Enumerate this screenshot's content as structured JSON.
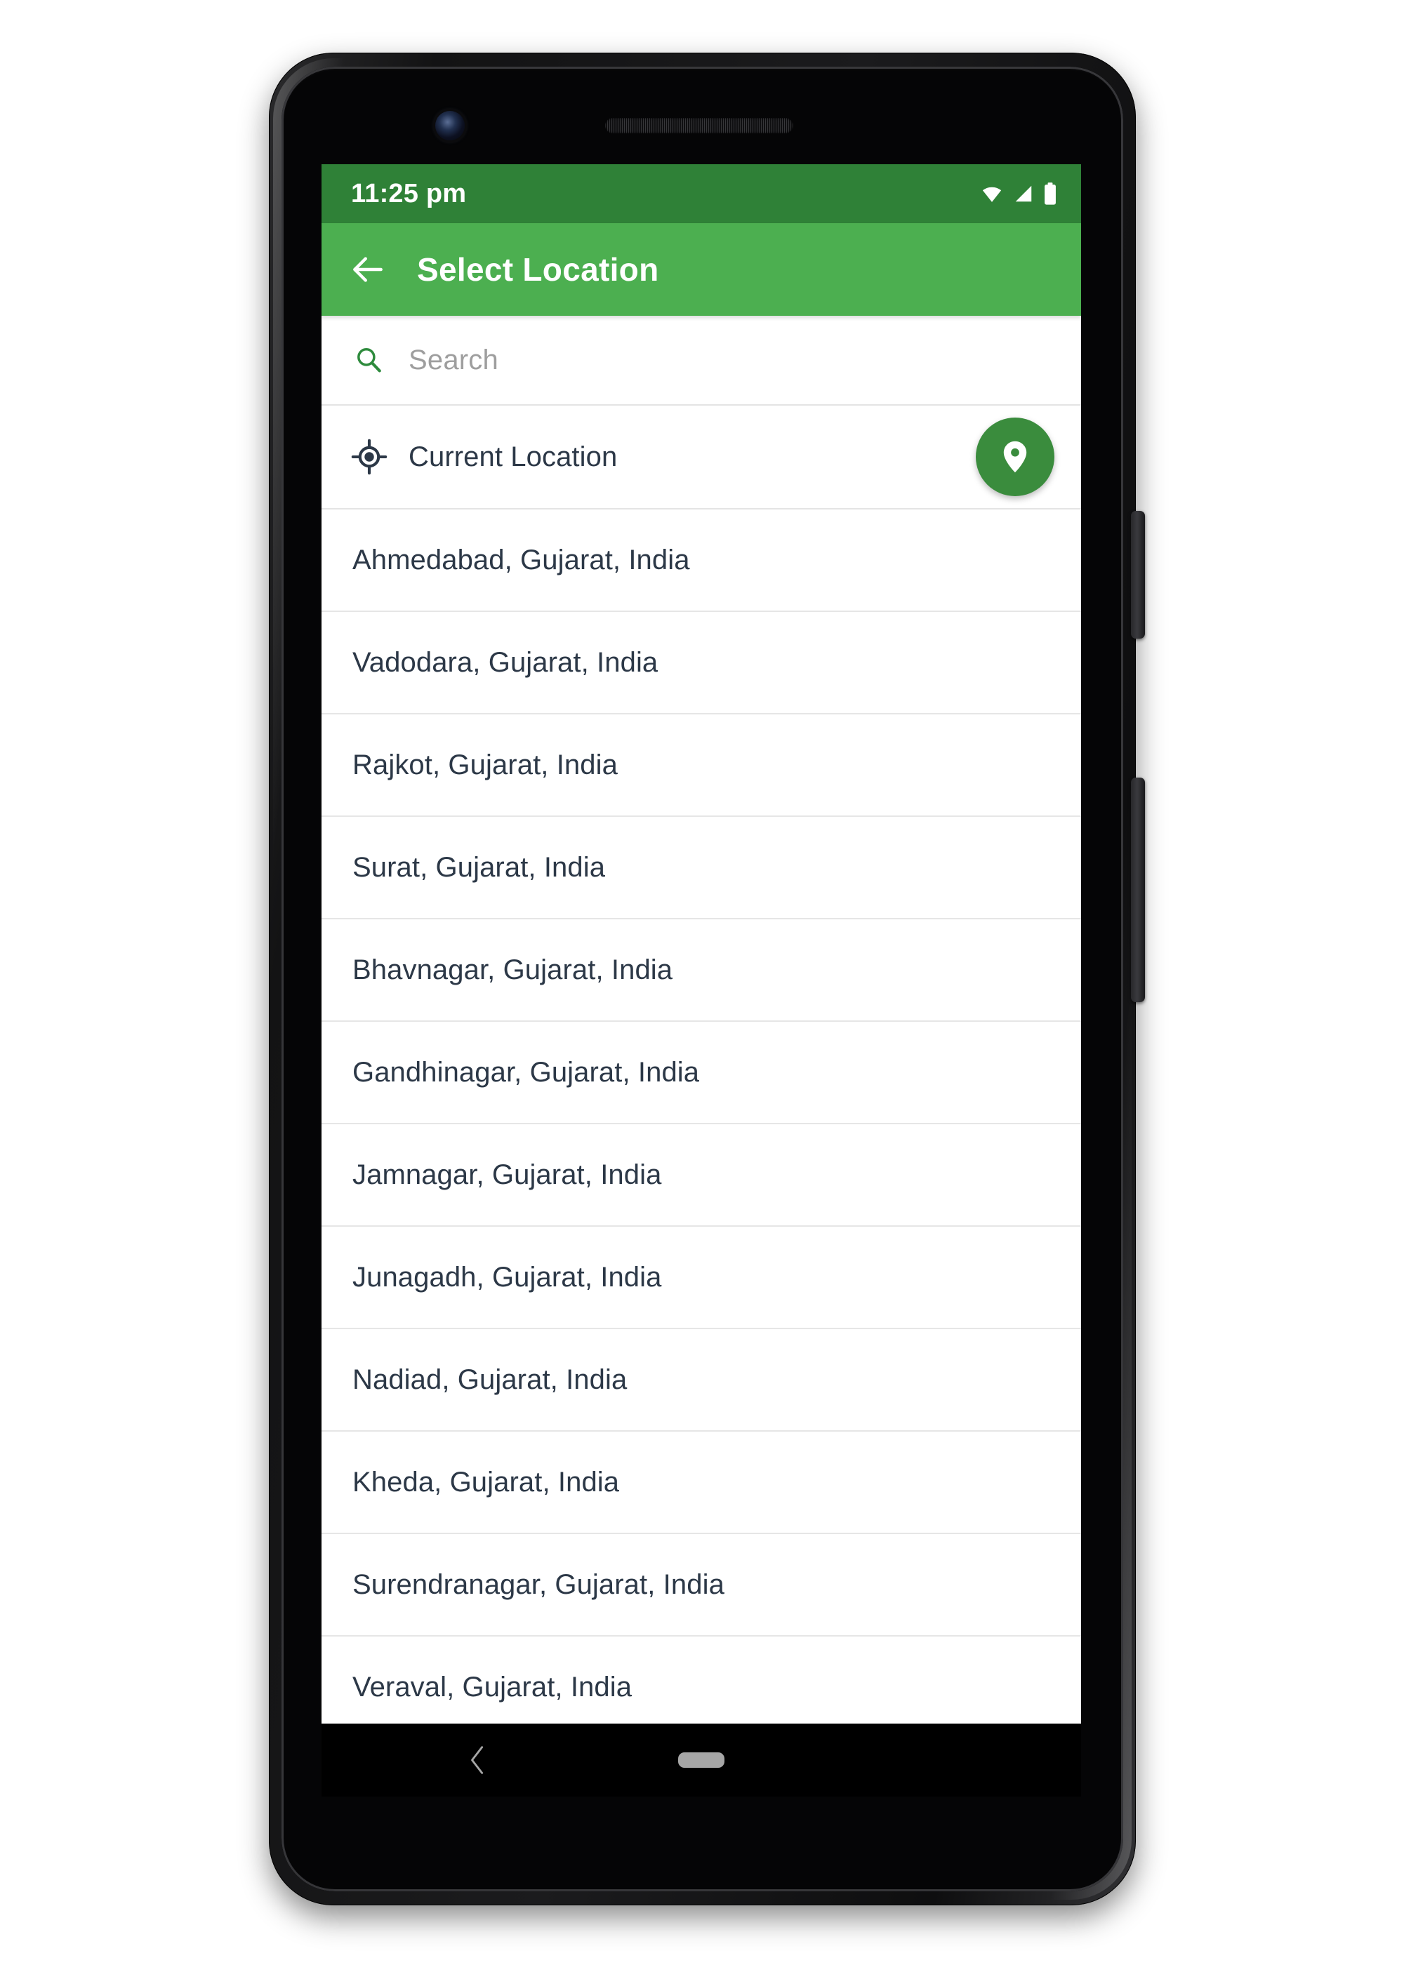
{
  "device": {
    "hardware": {
      "front_camera": "front-camera",
      "earpiece": "earpiece-speaker",
      "power_button": "power-button",
      "volume_button": "volume-rocker"
    }
  },
  "status_bar": {
    "time": "11:25 pm",
    "icons": [
      "wifi-icon",
      "cellular-signal-icon",
      "battery-icon"
    ],
    "background_color": "#2f8137"
  },
  "app_bar": {
    "back_icon": "back-arrow-icon",
    "title": "Select Location",
    "background_color": "#4caf50",
    "text_color": "#ffffff"
  },
  "search": {
    "icon": "search-icon",
    "value": "",
    "placeholder": "Search",
    "placeholder_color": "#9e9e9e",
    "icon_color": "#2e8b3d"
  },
  "current_location": {
    "icon": "gps-crosshair-icon",
    "label": "Current Location",
    "fab": {
      "icon": "map-pin-icon",
      "background_color": "#3a8c3d",
      "icon_color": "#ffffff"
    }
  },
  "location_list": {
    "text_color": "#2c3847",
    "divider_color": "#e6e6e6",
    "items": [
      {
        "label": "Ahmedabad, Gujarat, India"
      },
      {
        "label": "Vadodara, Gujarat, India"
      },
      {
        "label": "Rajkot, Gujarat, India"
      },
      {
        "label": "Surat, Gujarat, India"
      },
      {
        "label": "Bhavnagar, Gujarat, India"
      },
      {
        "label": "Gandhinagar, Gujarat, India"
      },
      {
        "label": "Jamnagar, Gujarat, India"
      },
      {
        "label": "Junagadh, Gujarat, India"
      },
      {
        "label": "Nadiad, Gujarat, India"
      },
      {
        "label": "Kheda, Gujarat, India"
      },
      {
        "label": "Surendranagar, Gujarat, India"
      },
      {
        "label": "Veraval, Gujarat, India"
      }
    ]
  },
  "navigation_bar": {
    "back_icon": "nav-back-chevron-icon",
    "home_icon": "nav-home-pill-icon",
    "background_color": "#000000"
  }
}
